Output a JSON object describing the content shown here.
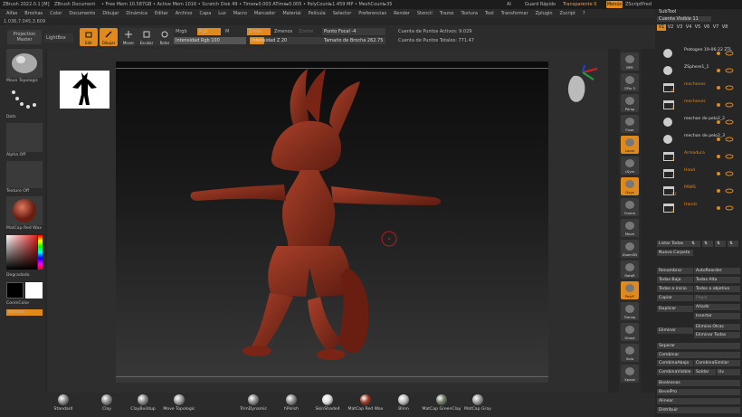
{
  "titlebar": {
    "app": "ZBrush 2022.0.1 [M]",
    "doc": "ZBrush Document",
    "stats": "• Free Mem 10.587GB • Active Mem 1016 • Scratch Disk 49 • Timer▸0.003 ATime▸0.005 • PolyCount▸1.459 MP • MeshCount▸35",
    "ai": "AI",
    "quicksave": "Guard Rápido",
    "transparent": "Transparente 0",
    "menus": "Menús",
    "script": "ZScriptPred"
  },
  "menubar": [
    "Alfas",
    "Brochas",
    "Color",
    "Documento",
    "Dibujar",
    "Dinámica",
    "Editar",
    "Archivo",
    "Capa",
    "Luz",
    "Macro",
    "Marcador",
    "Material",
    "Película",
    "Selector",
    "Preferencias",
    "Render",
    "Stencil",
    "Trazos",
    "Textura",
    "Tool",
    "Transformar",
    "Zplugin",
    "Zscript",
    "?"
  ],
  "coord": "1.036,7.045,3.609",
  "toolbar": {
    "projection_master": "Projection Master",
    "lightbox": "LightBox",
    "edit": "Edit",
    "draw": "Dibujar",
    "move": "Mover",
    "scale": "Escalar",
    "rotate": "Rotar",
    "mrgb": "Mrgb",
    "rgb": "Rgb",
    "m": "M",
    "zadd": "Zmás",
    "zsub": "Zmenos",
    "zcut": "Zcorte",
    "rgb_intensity": "Intensidad Rgb 100",
    "z_intensity": "Intensidad Z 20",
    "focal": "Punto Focal -4",
    "brush_size": "Tamaño de Brocha 262.75",
    "dynamic": "Dinámico",
    "active_points": "Cuenta de Puntos Activos: 9.029",
    "total_points": "Cuenta de Puntos Totales: 771.47"
  },
  "leftpanel": {
    "brush": "Move Topologic",
    "stroke": "Dots",
    "alpha": "Alpha Off",
    "texture": "Texture Off",
    "material": "MatCap Red Wax",
    "gradient": "Degradado",
    "switch_color": "ConmColor",
    "alternate": "Alternar"
  },
  "rightbar": [
    {
      "label": "BPR"
    },
    {
      "label": "SPix 3"
    },
    {
      "label": "Persp"
    },
    {
      "label": "Floor"
    },
    {
      "label": "Local"
    },
    {
      "label": "LSym"
    },
    {
      "label": "Qxyz"
    },
    {
      "label": "Frame"
    },
    {
      "label": "Move"
    },
    {
      "label": "Zoom3D"
    },
    {
      "label": "RotaR"
    },
    {
      "label": "PolyF"
    },
    {
      "label": "Transp"
    },
    {
      "label": "Ghost"
    },
    {
      "label": "Solo"
    },
    {
      "label": "Xpose"
    }
  ],
  "subtool": {
    "title": "SubTool",
    "visible_count": "Cuenta Visible 11",
    "tabs": [
      "V1",
      "V2",
      "V3",
      "V4",
      "V5",
      "V6",
      "V7",
      "V8"
    ],
    "items": [
      {
        "name": "Protogen 19-06-22 ZTL",
        "num": ""
      },
      {
        "name": "ZSphere1_1",
        "num": ""
      },
      {
        "name": "mechones",
        "num": "8"
      },
      {
        "name": "mechones",
        "num": "2"
      },
      {
        "name": "mechon de pelo2_2",
        "num": ""
      },
      {
        "name": "mechon de pelo2_3",
        "num": ""
      },
      {
        "name": "Armadura",
        "num": "3"
      },
      {
        "name": "Head",
        "num": "7"
      },
      {
        "name": "PAWS",
        "num": "12"
      },
      {
        "name": "Hands",
        "num": "2"
      }
    ],
    "list_all": "Listar Todas",
    "new_folder": "Nueva Carpeta",
    "rename": "Renombrar",
    "auto_reorder": "AutoReorder",
    "all_low": "Todas Baja",
    "all_high": "Todas Alta",
    "all_start": "Todos a inicio",
    "all_target": "Todos a objetivo",
    "copy": "Copiar",
    "paste": "Pegar",
    "duplicate": "Duplicar",
    "add": "Añadir",
    "insert": "Insertar",
    "delete": "Eliminar",
    "delete_other": "Elimina Otras",
    "delete_all": "Eliminar Todas",
    "split": "Separar",
    "merge": "Combinar",
    "merge_down": "CombinaAbajo",
    "merge_similar": "CombinaSimilar",
    "merge_visible": "CombinaVisible",
    "weld": "Soldar",
    "uv": "Uv",
    "boolean": "Booleanas",
    "bevelpro": "BevelPro",
    "align": "Alinear",
    "distribute": "Distribuir"
  },
  "bottombar": [
    {
      "label": "Standard",
      "color": "#8a8a8a"
    },
    {
      "label": "Clay",
      "color": "#8a8a8a"
    },
    {
      "label": "ClayBuildup",
      "color": "#8a8a8a"
    },
    {
      "label": "Move Topologic",
      "color": "#9a9a9a"
    },
    {
      "label": "TrimDynamic",
      "color": "#8a8a8a"
    },
    {
      "label": "hPolish",
      "color": "#8a8a8a"
    },
    {
      "label": "SkinShade4",
      "color": "#dddddd"
    },
    {
      "label": "MatCap Red Wax",
      "color": "#9c3a26"
    },
    {
      "label": "Blinn",
      "color": "#bbbbbb"
    },
    {
      "label": "MatCap GreenClay",
      "color": "#6f7a66"
    },
    {
      "label": "MatCap Gray",
      "color": "#999999"
    }
  ],
  "colors": {
    "accent": "#e08a1e",
    "model": "#8a2e1e",
    "bg": "#262626"
  }
}
